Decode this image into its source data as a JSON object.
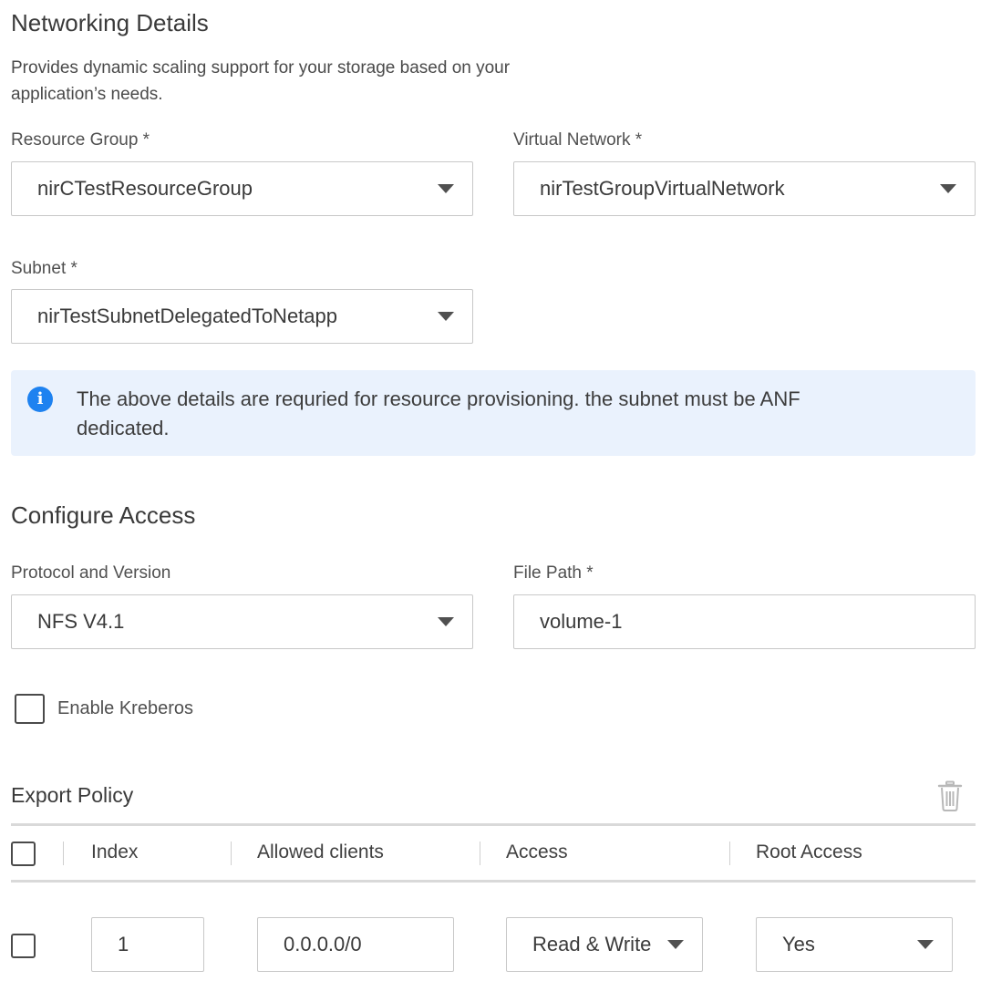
{
  "networking": {
    "title": "Networking Details",
    "description": "Provides dynamic scaling support for your storage based on your application’s needs.",
    "resource_group": {
      "label": "Resource Group *",
      "value": "nirCTestResourceGroup"
    },
    "virtual_network": {
      "label": "Virtual Network *",
      "value": "nirTestGroupVirtualNetwork"
    },
    "subnet": {
      "label": "Subnet *",
      "value": "nirTestSubnetDelegatedToNetapp"
    },
    "info_icon": "info-circle",
    "info_text": "The above details are requried for resource provisioning. the subnet must be ANF dedicated."
  },
  "access": {
    "title": "Configure Access",
    "protocol": {
      "label": "Protocol and Version",
      "value": "NFS V4.1"
    },
    "file_path": {
      "label": "File Path *",
      "value": "volume-1"
    },
    "kerberos": {
      "label": "Enable Kreberos",
      "checked": false
    }
  },
  "export_policy": {
    "title": "Export Policy",
    "delete_icon": "trash",
    "columns": [
      "Index",
      "Allowed clients",
      "Access",
      "Root Access"
    ],
    "rows": [
      {
        "checked": false,
        "index": "1",
        "allowed_clients": "0.0.0.0/0",
        "access": "Read & Write",
        "root_access": "Yes"
      }
    ]
  },
  "colors": {
    "info_bg": "#eaf2fd",
    "info_icon": "#1e82f0"
  }
}
